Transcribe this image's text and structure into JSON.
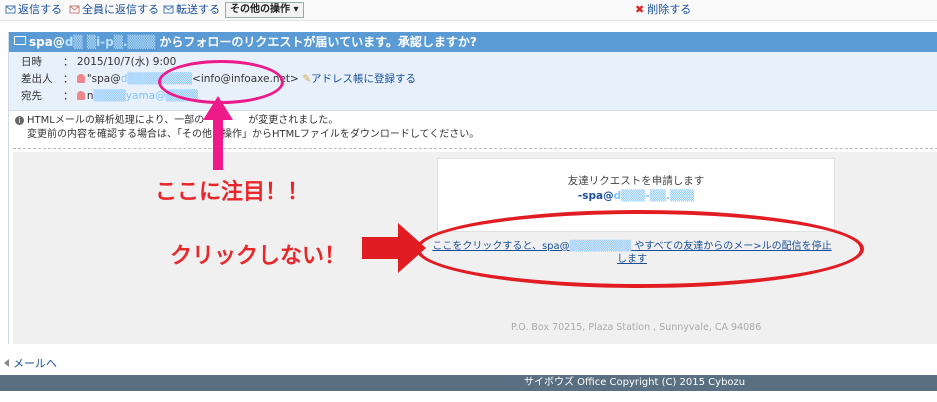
{
  "toolbar": {
    "reply": "返信する",
    "reply_all": "全員に返信する",
    "forward": "転送する",
    "other_actions": "その他の操作",
    "delete": "削除する"
  },
  "mail": {
    "subject_prefix": "spa@",
    "subject_redacted": "d▒ ▒i-p▒.▒▒▒",
    "subject_rest": "からフォローのリクエストが届いています。承認しますか?",
    "date_label": "日時",
    "date_value": "： 2015/10/7(水) 9:00",
    "from_label": "差出人",
    "from_name_prefix": "\"spa@",
    "from_name_redacted": "d▒▒▒▒▒▒▒▒",
    "from_address": "<info@infoaxe.net>",
    "from_add_link": "アドレス帳に登録する",
    "to_label": "宛先",
    "to_value_prefix": "n",
    "to_value_redacted": "▒▒▒▒yama@",
    "to_value_suffix": "▒▒▒▒",
    "notice_line1": "HTMLメールの解析処理により、一部の",
    "notice_line1b": "が変更されました。",
    "notice_line2": "変更前の内容を確認する場合は、「その他の操作」からHTMLファイルをダウンロードしてください。",
    "card_title": "友達リクエストを申請します",
    "card_email_prefix": "-spa@",
    "card_email_redacted": "d▒▒▒-▒▒.▒▒▒",
    "unsub_line1a": "ここをクリックすると、spa@",
    "unsub_line1_redacted": "▒▒▒▒▒▒▒▒",
    "unsub_line1b": "やすべての友達からのメー>ルの配信を停止",
    "unsub_line2": "します",
    "address": "P.O. Box 70215, Plaza Station , Sunnyvale, CA 94086"
  },
  "annotations": {
    "focus_here": "ここに注目！！",
    "dont_click": "クリックしない！"
  },
  "footer": {
    "back": "メールへ",
    "copyright": "サイボウズ Office Copyright (C) 2015 Cybozu"
  },
  "colors": {
    "subject_bar": "#5b9bd5",
    "annotation_red": "#e8262b",
    "annotation_pink": "#ee1a8a",
    "link": "#1a4f9c",
    "footer": "#5a6f82"
  }
}
